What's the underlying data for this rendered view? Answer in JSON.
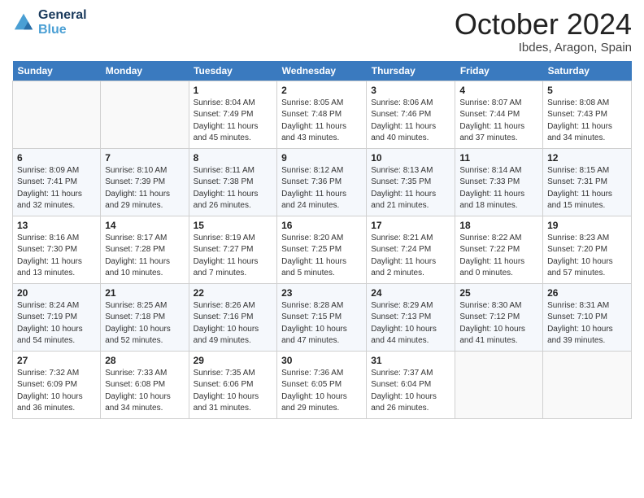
{
  "header": {
    "logo_line1": "General",
    "logo_line2": "Blue",
    "title": "October 2024",
    "location": "Ibdes, Aragon, Spain"
  },
  "days_of_week": [
    "Sunday",
    "Monday",
    "Tuesday",
    "Wednesday",
    "Thursday",
    "Friday",
    "Saturday"
  ],
  "weeks": [
    [
      {
        "day": "",
        "info": ""
      },
      {
        "day": "",
        "info": ""
      },
      {
        "day": "1",
        "info": "Sunrise: 8:04 AM\nSunset: 7:49 PM\nDaylight: 11 hours and 45 minutes."
      },
      {
        "day": "2",
        "info": "Sunrise: 8:05 AM\nSunset: 7:48 PM\nDaylight: 11 hours and 43 minutes."
      },
      {
        "day": "3",
        "info": "Sunrise: 8:06 AM\nSunset: 7:46 PM\nDaylight: 11 hours and 40 minutes."
      },
      {
        "day": "4",
        "info": "Sunrise: 8:07 AM\nSunset: 7:44 PM\nDaylight: 11 hours and 37 minutes."
      },
      {
        "day": "5",
        "info": "Sunrise: 8:08 AM\nSunset: 7:43 PM\nDaylight: 11 hours and 34 minutes."
      }
    ],
    [
      {
        "day": "6",
        "info": "Sunrise: 8:09 AM\nSunset: 7:41 PM\nDaylight: 11 hours and 32 minutes."
      },
      {
        "day": "7",
        "info": "Sunrise: 8:10 AM\nSunset: 7:39 PM\nDaylight: 11 hours and 29 minutes."
      },
      {
        "day": "8",
        "info": "Sunrise: 8:11 AM\nSunset: 7:38 PM\nDaylight: 11 hours and 26 minutes."
      },
      {
        "day": "9",
        "info": "Sunrise: 8:12 AM\nSunset: 7:36 PM\nDaylight: 11 hours and 24 minutes."
      },
      {
        "day": "10",
        "info": "Sunrise: 8:13 AM\nSunset: 7:35 PM\nDaylight: 11 hours and 21 minutes."
      },
      {
        "day": "11",
        "info": "Sunrise: 8:14 AM\nSunset: 7:33 PM\nDaylight: 11 hours and 18 minutes."
      },
      {
        "day": "12",
        "info": "Sunrise: 8:15 AM\nSunset: 7:31 PM\nDaylight: 11 hours and 15 minutes."
      }
    ],
    [
      {
        "day": "13",
        "info": "Sunrise: 8:16 AM\nSunset: 7:30 PM\nDaylight: 11 hours and 13 minutes."
      },
      {
        "day": "14",
        "info": "Sunrise: 8:17 AM\nSunset: 7:28 PM\nDaylight: 11 hours and 10 minutes."
      },
      {
        "day": "15",
        "info": "Sunrise: 8:19 AM\nSunset: 7:27 PM\nDaylight: 11 hours and 7 minutes."
      },
      {
        "day": "16",
        "info": "Sunrise: 8:20 AM\nSunset: 7:25 PM\nDaylight: 11 hours and 5 minutes."
      },
      {
        "day": "17",
        "info": "Sunrise: 8:21 AM\nSunset: 7:24 PM\nDaylight: 11 hours and 2 minutes."
      },
      {
        "day": "18",
        "info": "Sunrise: 8:22 AM\nSunset: 7:22 PM\nDaylight: 11 hours and 0 minutes."
      },
      {
        "day": "19",
        "info": "Sunrise: 8:23 AM\nSunset: 7:20 PM\nDaylight: 10 hours and 57 minutes."
      }
    ],
    [
      {
        "day": "20",
        "info": "Sunrise: 8:24 AM\nSunset: 7:19 PM\nDaylight: 10 hours and 54 minutes."
      },
      {
        "day": "21",
        "info": "Sunrise: 8:25 AM\nSunset: 7:18 PM\nDaylight: 10 hours and 52 minutes."
      },
      {
        "day": "22",
        "info": "Sunrise: 8:26 AM\nSunset: 7:16 PM\nDaylight: 10 hours and 49 minutes."
      },
      {
        "day": "23",
        "info": "Sunrise: 8:28 AM\nSunset: 7:15 PM\nDaylight: 10 hours and 47 minutes."
      },
      {
        "day": "24",
        "info": "Sunrise: 8:29 AM\nSunset: 7:13 PM\nDaylight: 10 hours and 44 minutes."
      },
      {
        "day": "25",
        "info": "Sunrise: 8:30 AM\nSunset: 7:12 PM\nDaylight: 10 hours and 41 minutes."
      },
      {
        "day": "26",
        "info": "Sunrise: 8:31 AM\nSunset: 7:10 PM\nDaylight: 10 hours and 39 minutes."
      }
    ],
    [
      {
        "day": "27",
        "info": "Sunrise: 7:32 AM\nSunset: 6:09 PM\nDaylight: 10 hours and 36 minutes."
      },
      {
        "day": "28",
        "info": "Sunrise: 7:33 AM\nSunset: 6:08 PM\nDaylight: 10 hours and 34 minutes."
      },
      {
        "day": "29",
        "info": "Sunrise: 7:35 AM\nSunset: 6:06 PM\nDaylight: 10 hours and 31 minutes."
      },
      {
        "day": "30",
        "info": "Sunrise: 7:36 AM\nSunset: 6:05 PM\nDaylight: 10 hours and 29 minutes."
      },
      {
        "day": "31",
        "info": "Sunrise: 7:37 AM\nSunset: 6:04 PM\nDaylight: 10 hours and 26 minutes."
      },
      {
        "day": "",
        "info": ""
      },
      {
        "day": "",
        "info": ""
      }
    ]
  ]
}
